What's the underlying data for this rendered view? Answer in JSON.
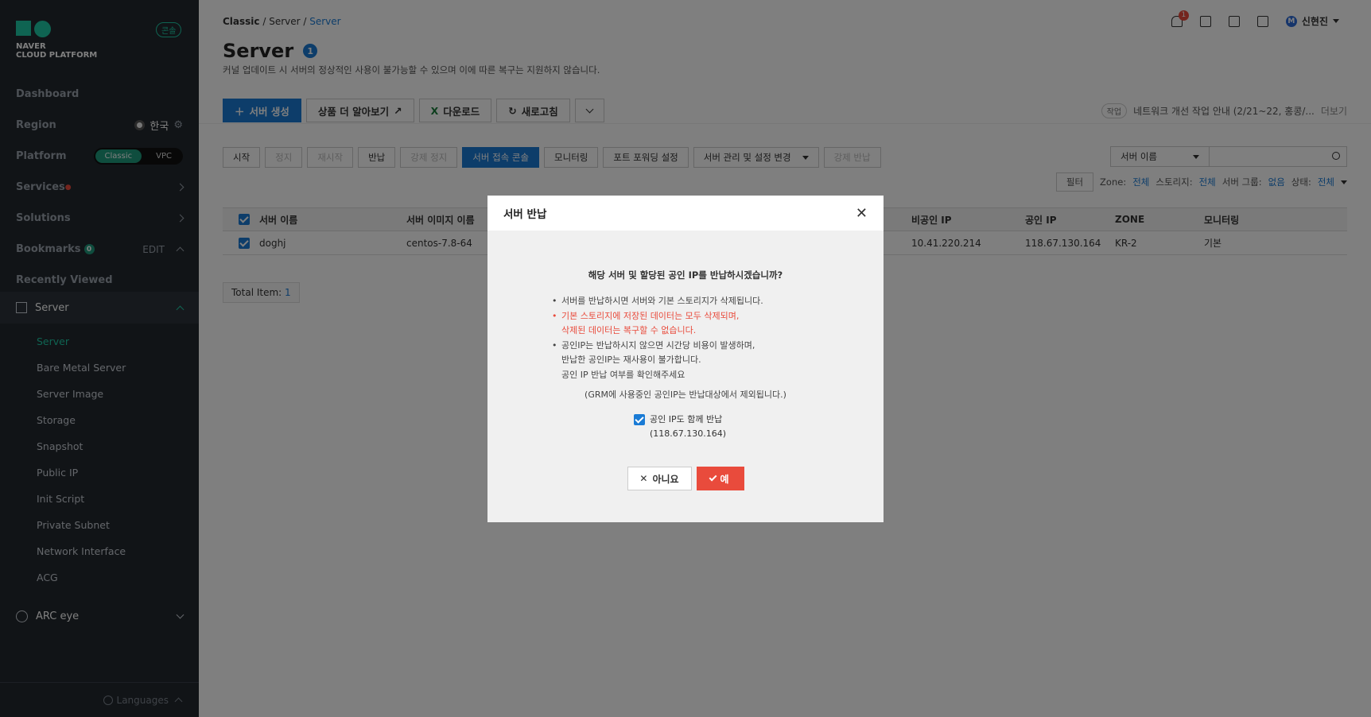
{
  "sidebar": {
    "brand_line1": "NAVER",
    "brand_line2": "CLOUD PLATFORM",
    "console_badge": "콘솔",
    "dashboard": "Dashboard",
    "region_label": "Region",
    "region_value": "한국",
    "platform_label": "Platform",
    "platform_options": [
      "Classic",
      "VPC"
    ],
    "services": "Services",
    "solutions": "Solutions",
    "bookmarks": "Bookmarks",
    "bookmarks_count": "0",
    "bookmarks_edit": "EDIT",
    "recently_viewed": "Recently Viewed",
    "group_server": "Server",
    "sub_items": [
      "Server",
      "Bare Metal Server",
      "Server Image",
      "Storage",
      "Snapshot",
      "Public IP",
      "Init Script",
      "Private Subnet",
      "Network Interface",
      "ACG"
    ],
    "arc_eye": "ARC eye",
    "languages": "Languages"
  },
  "header": {
    "breadcrumb": [
      "Classic",
      "Server",
      "Server"
    ],
    "notifications": "1",
    "user_initial": "M",
    "user_name": "신현진",
    "title": "Server",
    "title_badge": "1",
    "subtitle": "커널 업데이트 시 서버의 정상적인 사용이 불가능할 수 있으며 이에 따른 복구는 지원하지 않습니다."
  },
  "toolbar": {
    "create": "서버 생성",
    "learn_more": "상품 더 알아보기",
    "download": "다운로드",
    "refresh": "새로고침",
    "notice_tag": "작업",
    "notice_text": "네트워크 개선 작업 안내 (2/21~22, 홍콩/...",
    "more": "더보기"
  },
  "actions": [
    "시작",
    "정지",
    "재시작",
    "반납",
    "강제 정지",
    "서버 접속 콘솔",
    "모니터링",
    "포트 포워딩 설정",
    "서버 관리 및 설정 변경",
    "강제 반납"
  ],
  "search": {
    "field": "서버 이름"
  },
  "filter": {
    "label": "필터",
    "zone_label": "Zone:",
    "zone_value": "전체",
    "storage_label": "스토리지:",
    "storage_value": "전체",
    "group_label": "서버 그룹:",
    "group_value": "없음",
    "status_label": "상태:",
    "status_value": "전체"
  },
  "table": {
    "headers": [
      "서버 이름",
      "서버 이미지 이름",
      "비공인 IP",
      "공인 IP",
      "ZONE",
      "모니터링"
    ],
    "row": {
      "name": "doghj",
      "image": "centos-7.8-64",
      "private_ip": "10.41.220.214",
      "public_ip": "118.67.130.164",
      "zone": "KR-2",
      "monitoring": "기본"
    }
  },
  "total": {
    "label": "Total Item:",
    "count": "1"
  },
  "modal": {
    "title": "서버 반납",
    "question": "해당 서버 및 할당된 공인 IP를 반납하시겠습니까?",
    "bullet1": "서버를 반납하시면 서버와 기본 스토리지가 삭제됩니다.",
    "bullet2a": "기본 스토리지에 저장된 데이터는 모두 삭제되며,",
    "bullet2b": "삭제된 데이터는 복구할 수 없습니다.",
    "bullet3a": "공인IP는 반납하시지 않으면 시간당 비용이 발생하며,",
    "bullet3b": "반납한 공인IP는 재사용이 불가합니다.",
    "bullet3c": "공인 IP 반납 여부를 확인해주세요",
    "grm_note": "(GRM에 사용중인 공인IP는 반납대상에서 제외됩니다.)",
    "checkbox_label": "공인 IP도 함께 반납",
    "checkbox_ip": "(118.67.130.164)",
    "no": "아니요",
    "yes": "예"
  }
}
